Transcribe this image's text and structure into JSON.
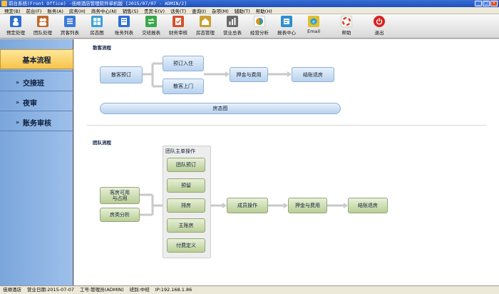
{
  "window": {
    "title": "前台系统(Front Office) -佳顺酒店管理软件单机版 [2015/07/07 - ADMIN/2]"
  },
  "menu": [
    "预定(B)",
    "前台(F)",
    "账务(A)",
    "房务(H)",
    "商务中心(N)",
    "销售(S)",
    "贵宾卡(V)",
    "话务(T)",
    "查询(I)",
    "杂项(M)",
    "辅助(T)",
    "帮助(H)"
  ],
  "toolbar": [
    {
      "label": "预定处理",
      "icon": "reservation-icon",
      "color": "#2d6fd0"
    },
    {
      "label": "团队处理",
      "icon": "group-icon",
      "color": "#c06a30"
    },
    {
      "label": "宾客列表",
      "icon": "guest-list-icon",
      "color": "#3a7ad8"
    },
    {
      "label": "房态图",
      "icon": "room-status-icon",
      "color": "#3aa0d8"
    },
    {
      "label": "账务列表",
      "icon": "accounts-icon",
      "color": "#2d6fd0"
    },
    {
      "label": "交班报表",
      "icon": "shift-report-icon",
      "color": "#3aa84a"
    },
    {
      "label": "财务审核",
      "icon": "audit-icon",
      "color": "#d8502d"
    },
    {
      "label": "房态管理",
      "icon": "room-manage-icon",
      "color": "#c8a030"
    },
    {
      "label": "营业总表",
      "icon": "revenue-icon",
      "color": "#6a6a6a"
    },
    {
      "label": "经营分析",
      "icon": "analysis-icon",
      "color": "#e09020"
    },
    {
      "label": "报表中心",
      "icon": "report-center-icon",
      "color": "#2d8fd0"
    },
    {
      "label": "Email",
      "icon": "email-icon",
      "color": "#e0c030"
    },
    {
      "label": "帮助",
      "icon": "help-icon",
      "color": "#d84020"
    },
    {
      "label": "退出",
      "icon": "exit-icon",
      "color": "#d82020"
    }
  ],
  "sidebar": {
    "items": [
      {
        "label": "基本流程",
        "active": true
      },
      {
        "label": "交接班",
        "active": false
      },
      {
        "label": "夜审",
        "active": false
      },
      {
        "label": "账务审核",
        "active": false
      }
    ]
  },
  "flow": {
    "walkin": {
      "title": "散客流程",
      "reserve": "散客预订",
      "checkin": "预订入住",
      "walkin": "散客上门",
      "deposit": "押金与费用",
      "checkout": "结账退房",
      "roommap": "房态图"
    },
    "group": {
      "title": "团队流程",
      "master_title": "团队主单操作",
      "master_ops": [
        "团队预订",
        "预留",
        "排房",
        "主账房",
        "付费定义"
      ],
      "availability": "客房可用\n与占用",
      "analysis": "房类分析",
      "member": "成员操作",
      "deposit": "押金与费用",
      "checkout": "结账退房"
    }
  },
  "status": [
    "佳顺酒店",
    "营业日期:2015-07-07",
    "工号:管理员(ADMIN)",
    "班别:中班",
    "IP:192.168.1.86"
  ]
}
